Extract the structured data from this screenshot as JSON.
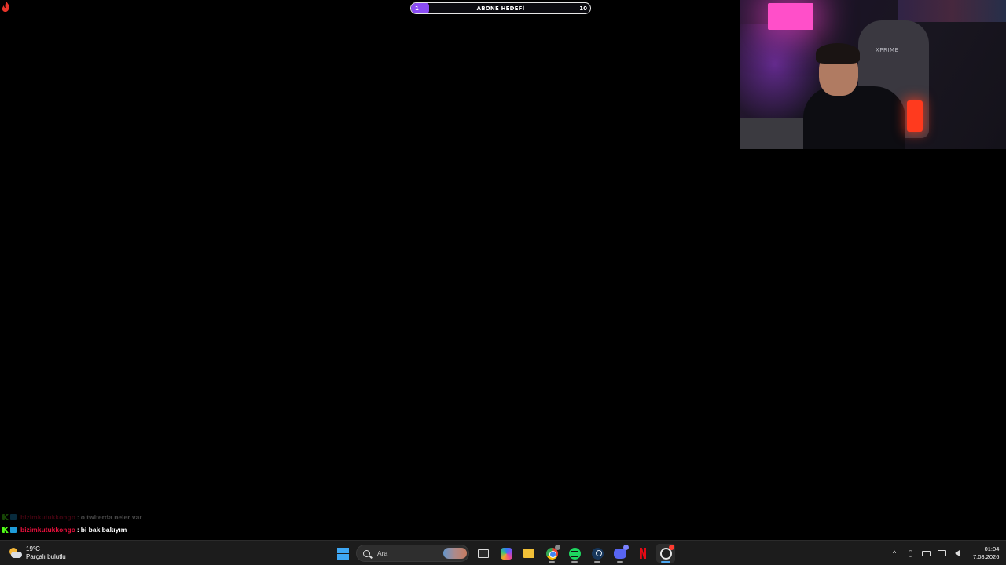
{
  "overlay": {
    "subscriber_goal": {
      "label": "ABONE HEDEFİ",
      "current": "1",
      "target": "10",
      "progress_fraction": 0.1,
      "fill_color": "#8b4cf5"
    }
  },
  "chat": {
    "messages": [
      {
        "user": "bizimkutukkongo",
        "text": "o twiterda neler var",
        "faded": true,
        "user_color": "#e8103c"
      },
      {
        "user": "bizimkutukkongo",
        "text": "bi bak bakıyım",
        "faded": false,
        "user_color": "#e8103c"
      }
    ],
    "separator": ":"
  },
  "taskbar": {
    "weather": {
      "temperature": "19°C",
      "condition": "Parçalı bulutlu",
      "icon": "partly-cloudy-icon"
    },
    "search": {
      "placeholder": "Ara"
    },
    "apps": [
      {
        "name": "start",
        "icon": "windows-start-icon"
      },
      {
        "name": "task-view",
        "icon": "task-view-icon"
      },
      {
        "name": "copilot",
        "icon": "copilot-icon"
      },
      {
        "name": "file-explorer",
        "icon": "folder-icon"
      },
      {
        "name": "chrome",
        "icon": "chrome-icon"
      },
      {
        "name": "spotify",
        "icon": "spotify-icon"
      },
      {
        "name": "steam",
        "icon": "steam-icon"
      },
      {
        "name": "discord",
        "icon": "discord-icon"
      },
      {
        "name": "netflix",
        "icon": "netflix-icon"
      },
      {
        "name": "obs",
        "icon": "obs-icon"
      }
    ],
    "tray": {
      "chevron": "^",
      "time": "01:04",
      "date": "7.08.2026"
    }
  },
  "webcam": {
    "chair_brand": "XPRIME"
  },
  "colors": {
    "accent": "#4ca7f0",
    "goal_fill": "#8b4cf5",
    "chat_user": "#e8103c",
    "taskbar_bg": "#1c1c1c"
  }
}
